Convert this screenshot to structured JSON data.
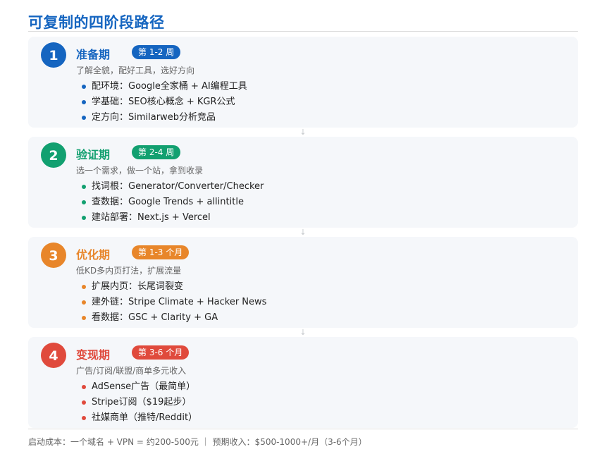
{
  "title": "可复制的四阶段路径",
  "stages": [
    {
      "number": "1",
      "name": "准备期",
      "duration": "第 1-2 周",
      "subtitle": "了解全貌，配好工具，选好方向",
      "color": "#1565c0",
      "items": [
        "配环境：Google全家桶 + AI编程工具",
        "学基础：SEO核心概念 + KGR公式",
        "定方向：Similarweb分析竞品"
      ]
    },
    {
      "number": "2",
      "name": "验证期",
      "duration": "第 2-4 周",
      "subtitle": "选一个需求，做一个站，拿到收录",
      "color": "#12a070",
      "items": [
        "找词根：Generator/Converter/Checker",
        "查数据：Google Trends + allintitle",
        "建站部署：Next.js + Vercel"
      ]
    },
    {
      "number": "3",
      "name": "优化期",
      "duration": "第 1-3 个月",
      "subtitle": "低KD多内页打法，扩展流量",
      "color": "#e8862a",
      "items": [
        "扩展内页：长尾词裂变",
        "建外链：Stripe Climate + Hacker News",
        "看数据：GSC + Clarity + GA"
      ]
    },
    {
      "number": "4",
      "name": "变现期",
      "duration": "第 3-6 个月",
      "subtitle": "广告/订阅/联盟/商单多元收入",
      "color": "#e04a3c",
      "items": [
        "AdSense广告（最简单）",
        "Stripe订阅（$19起步）",
        "社媒商单（推特/Reddit）"
      ]
    }
  ],
  "arrow_icon": "arrow-down-icon",
  "footer": "启动成本：一个域名 + VPN = 约200-500元 ｜ 预期收入：$500-1000+/月（3-6个月）"
}
